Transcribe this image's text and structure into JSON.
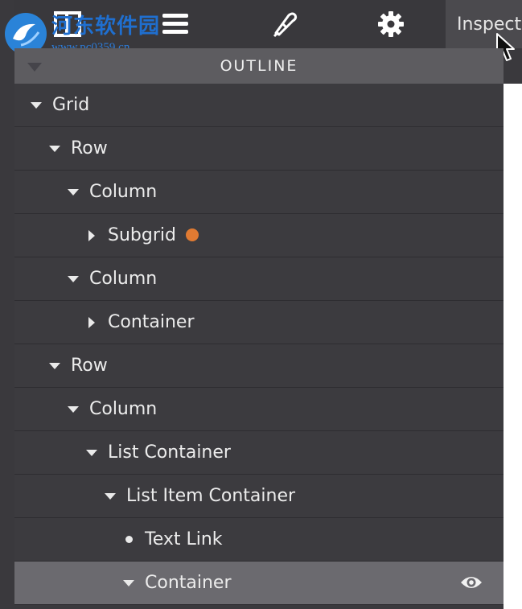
{
  "watermark": {
    "title": "河东软件园",
    "url": "www.pc0359.cn"
  },
  "toolbar": {
    "icons": [
      "layout-icon",
      "menu-icon",
      "brush-icon",
      "gear-icon"
    ],
    "inspect_tab": "Inspect"
  },
  "outline": {
    "header": "OUTLINE",
    "items": [
      {
        "label": "Grid",
        "depth": 0,
        "toggle": "expanded"
      },
      {
        "label": "Row",
        "depth": 1,
        "toggle": "expanded"
      },
      {
        "label": "Column",
        "depth": 2,
        "toggle": "expanded"
      },
      {
        "label": "Subgrid",
        "depth": 3,
        "toggle": "collapsed",
        "badge_color": "#e07a32"
      },
      {
        "label": "Column",
        "depth": 2,
        "toggle": "expanded"
      },
      {
        "label": "Container",
        "depth": 3,
        "toggle": "collapsed"
      },
      {
        "label": "Row",
        "depth": 1,
        "toggle": "expanded"
      },
      {
        "label": "Column",
        "depth": 2,
        "toggle": "expanded"
      },
      {
        "label": "List Container",
        "depth": 3,
        "toggle": "expanded"
      },
      {
        "label": "List Item Container",
        "depth": 4,
        "toggle": "expanded"
      },
      {
        "label": "Text Link",
        "depth": 5,
        "toggle": "leaf"
      },
      {
        "label": "Container",
        "depth": 5,
        "toggle": "expanded",
        "selected": true,
        "icon": "eye-icon"
      }
    ]
  },
  "colors": {
    "accent_badge": "#e07a32",
    "selected_row": "#6b6a6f"
  }
}
